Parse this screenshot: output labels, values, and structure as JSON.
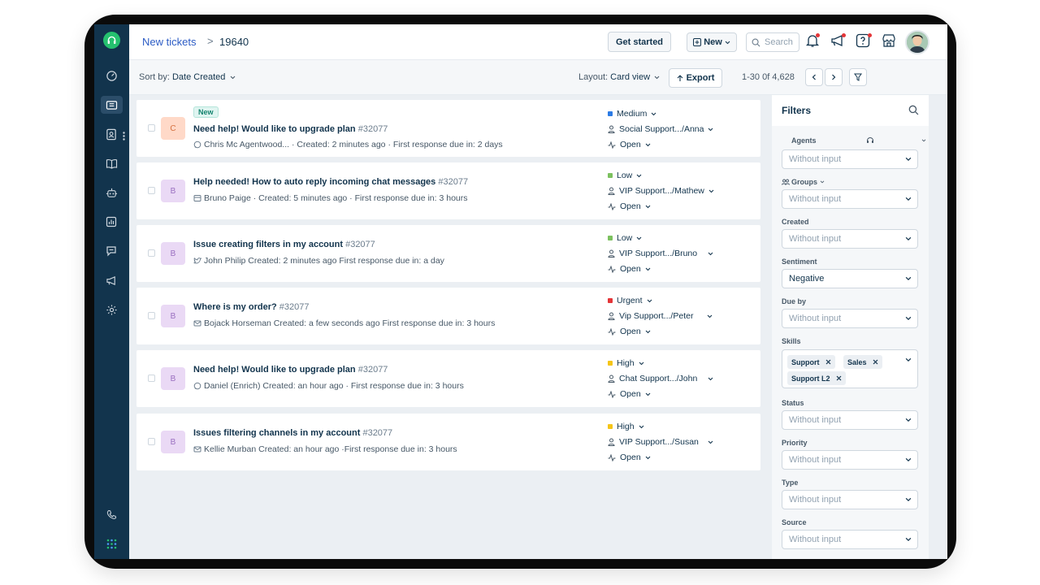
{
  "header": {
    "breadcrumb_link": "New tickets",
    "breadcrumb_sep": ">",
    "breadcrumb_id": "19640",
    "get_started": "Get started",
    "new_label": "New",
    "search_placeholder": "Search"
  },
  "subheader": {
    "sort_label": "Sort by:",
    "sort_value": "Date Created",
    "layout_label": "Layout:",
    "layout_value": "Card view",
    "export_label": "Export",
    "pagination": "1-30 0f 4,628"
  },
  "tickets": [
    {
      "initial": "C",
      "badge": "New",
      "subject": "Need help! Would like to upgrade plan",
      "number": "#32077",
      "meta": "Chris Mc Agentwood... · Created: 2 minutes ago · First response due in: 2 days",
      "priority": "Medium",
      "priority_color": "#2c7be5",
      "group": "Social Support.../Anna",
      "status": "Open"
    },
    {
      "initial": "B",
      "badge": "",
      "subject": "Help needed! How to auto reply incoming chat messages",
      "number": "#32077",
      "meta": "Bruno Paige · Created: 5 minutes ago · First response due in: 3 hours",
      "priority": "Low",
      "priority_color": "#7cc15f",
      "group": "VIP Support.../Mathew",
      "status": "Open"
    },
    {
      "initial": "B",
      "badge": "",
      "subject": "Issue creating filters in my account",
      "number": "#32077",
      "meta": "John Philip   Created: 2 minutes ago   First response due in: a day",
      "priority": "Low",
      "priority_color": "#7cc15f",
      "group": "VIP Support.../Bruno",
      "status": "Open"
    },
    {
      "initial": "B",
      "badge": "",
      "subject": "Where is my order?",
      "number": "#32077",
      "meta": "Bojack Horseman   Created: a few seconds ago   First response due in: 3 hours",
      "priority": "Urgent",
      "priority_color": "#e43538",
      "group": "Vip Support.../Peter",
      "status": "Open"
    },
    {
      "initial": "B",
      "badge": "",
      "subject": "Need help! Would like to upgrade plan",
      "number": "#32077",
      "meta": "Daniel (Enrich)   Created: an hour ago · First response due in: 3 hours",
      "priority": "High",
      "priority_color": "#f5c518",
      "group": "Chat Support.../John",
      "status": "Open"
    },
    {
      "initial": "B",
      "badge": "",
      "subject": "Issues filtering channels in my account",
      "number": "#32077",
      "meta": "Kellie Murban   Created: an hour ago  ·First response due in: 3 hours",
      "priority": "High",
      "priority_color": "#f5c518",
      "group": "VIP Support.../Susan",
      "status": "Open"
    }
  ],
  "filters": {
    "title": "Filters",
    "agents_label": "Agents",
    "groups_label": "Groups",
    "created_label": "Created",
    "sentiment_label": "Sentiment",
    "sentiment_value": "Negative",
    "due_by_label": "Due by",
    "skills_label": "Skills",
    "skills": [
      "Support",
      "Sales",
      "Support L2"
    ],
    "status_label": "Status",
    "priority_label": "Priority",
    "type_label": "Type",
    "source_label": "Source",
    "placeholder": "Without input"
  },
  "colors": {
    "sidebar": "#12344d",
    "link": "#2c5cc5",
    "avatar_c_bg": "#ffd9c8",
    "avatar_b_bg": "#ead9f5"
  }
}
